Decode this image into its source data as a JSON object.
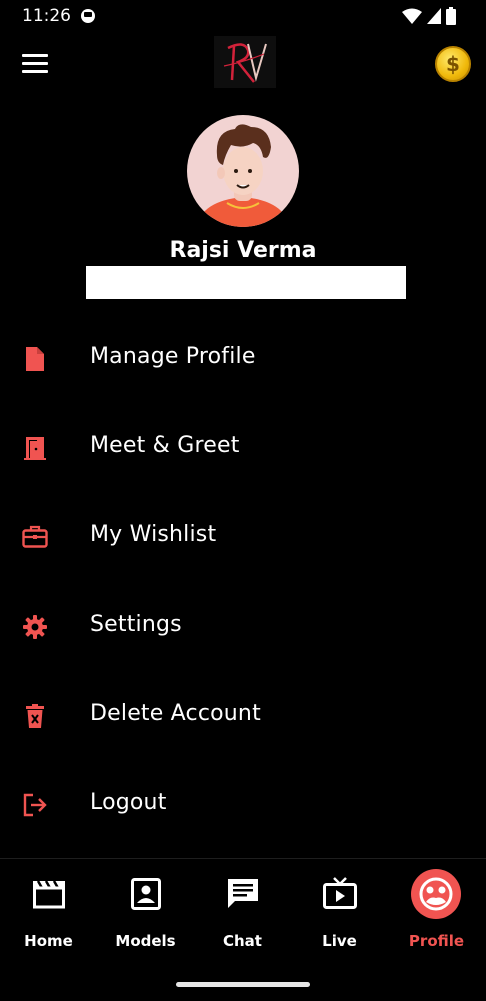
{
  "status_bar": {
    "time": "11:26"
  },
  "header": {
    "logo_text": "RV",
    "coin_symbol": "$"
  },
  "profile": {
    "name": "Rajsi Verma",
    "email": ""
  },
  "menu": {
    "items": [
      {
        "label": "Manage Profile",
        "icon": "file-icon"
      },
      {
        "label": "Meet & Greet",
        "icon": "door-icon"
      },
      {
        "label": "My Wishlist",
        "icon": "briefcase-icon"
      },
      {
        "label": "Settings",
        "icon": "gear-icon"
      },
      {
        "label": "Delete Account",
        "icon": "trash-icon"
      },
      {
        "label": "Logout",
        "icon": "logout-icon"
      }
    ]
  },
  "bottom_nav": {
    "items": [
      {
        "label": "Home",
        "icon": "clapperboard-icon"
      },
      {
        "label": "Models",
        "icon": "contact-card-icon"
      },
      {
        "label": "Chat",
        "icon": "chat-bubble-icon"
      },
      {
        "label": "Live",
        "icon": "tv-icon"
      },
      {
        "label": "Profile",
        "icon": "profile-icon"
      }
    ],
    "active": "Profile"
  },
  "colors": {
    "accent": "#f05451",
    "background": "#000000",
    "coin": "#f0b90b"
  }
}
